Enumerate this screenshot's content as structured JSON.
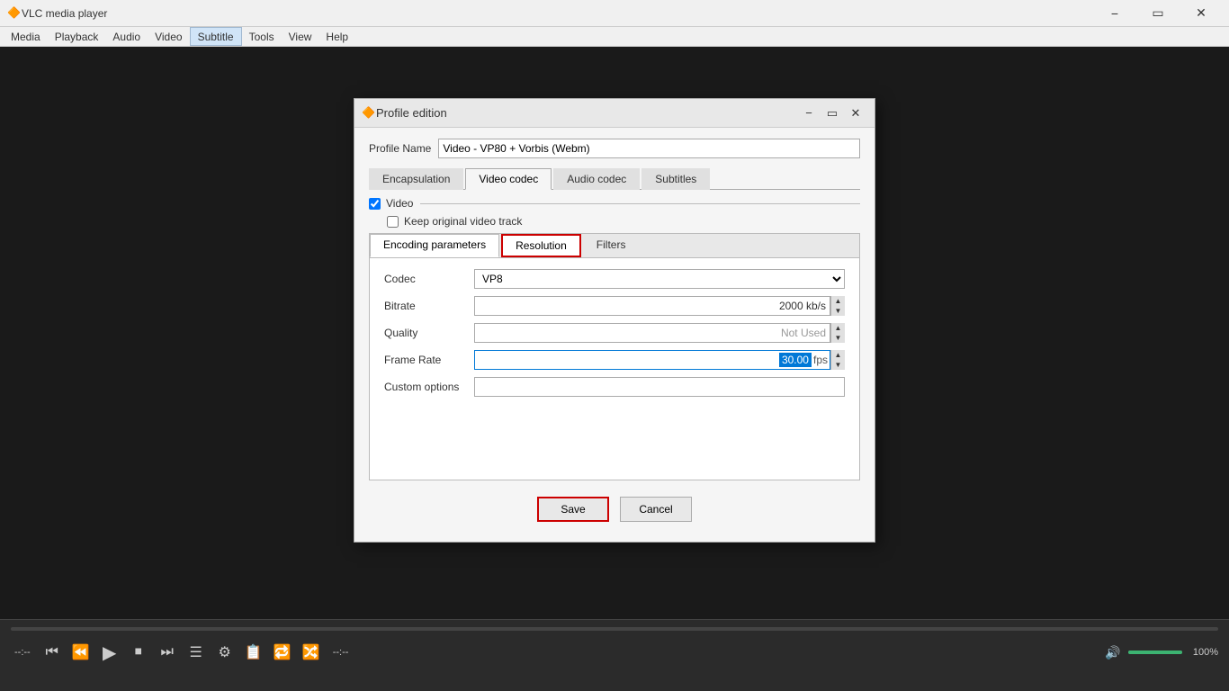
{
  "app": {
    "title": "VLC media player",
    "icon": "🔶"
  },
  "menu": {
    "items": [
      "Media",
      "Playback",
      "Audio",
      "Video",
      "Subtitle",
      "Tools",
      "View",
      "Help"
    ]
  },
  "dialog": {
    "title": "Profile edition",
    "profile_name_label": "Profile Name",
    "profile_name_value": "Video - VP80 + Vorbis (Webm)",
    "tabs": [
      {
        "label": "Encapsulation",
        "active": false
      },
      {
        "label": "Video codec",
        "active": true
      },
      {
        "label": "Audio codec",
        "active": false
      },
      {
        "label": "Subtitles",
        "active": false
      }
    ],
    "video_checkbox_label": "Video",
    "keep_original_label": "Keep original video track",
    "inner_tabs": [
      {
        "label": "Encoding parameters",
        "active": true
      },
      {
        "label": "Resolution",
        "active": false,
        "highlighted": true
      },
      {
        "label": "Filters",
        "active": false
      }
    ],
    "fields": {
      "codec_label": "Codec",
      "codec_value": "VP8",
      "bitrate_label": "Bitrate",
      "bitrate_value": "2000 kb/s",
      "quality_label": "Quality",
      "quality_value": "Not Used",
      "framerate_label": "Frame Rate",
      "framerate_value": "30.00",
      "framerate_unit": "fps",
      "custom_options_label": "Custom options",
      "custom_options_value": ""
    },
    "save_label": "Save",
    "cancel_label": "Cancel"
  },
  "bottom_bar": {
    "time_elapsed": "--:--",
    "time_total": "--:--",
    "volume_label": "100%",
    "transport_buttons": [
      "prev-track",
      "prev",
      "stop",
      "next",
      "open-playlist",
      "extended-settings",
      "playlist",
      "loop",
      "random"
    ]
  }
}
